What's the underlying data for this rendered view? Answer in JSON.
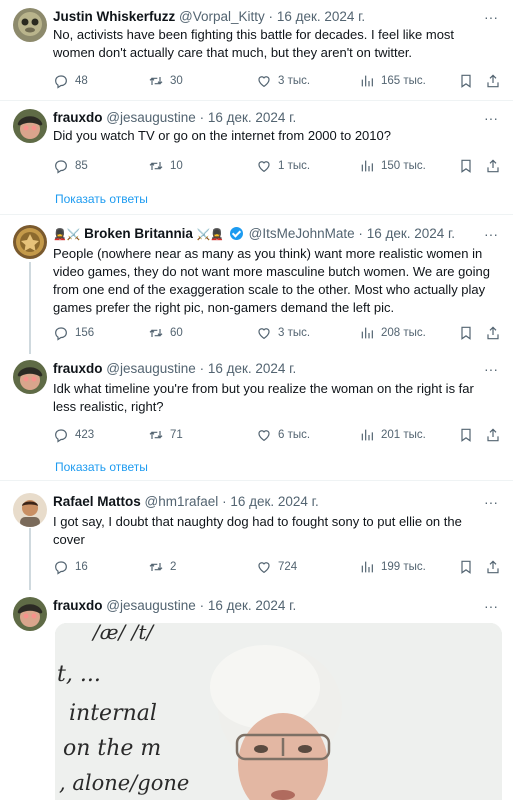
{
  "tweets": [
    {
      "name": "Justin Whiskerfuzz",
      "handle": "@Vorpal_Kitty",
      "date": "16 дек. 2024 г.",
      "text": "No, activists have been fighting this battle for decades. I feel like most women don't actually care that much, but they aren't on twitter.",
      "replies": "48",
      "retweets": "30",
      "likes": "3 тыс.",
      "views": "165 тыс."
    },
    {
      "name": "frauxdo",
      "handle": "@jesaugustine",
      "date": "16 дек. 2024 г.",
      "text": "Did you watch TV or go on the internet from 2000 to 2010?",
      "replies": "85",
      "retweets": "10",
      "likes": "1 тыс.",
      "views": "150 тыс.",
      "show_replies": "Показать ответы"
    },
    {
      "name_prefix": "💂‍♀️⚔️",
      "name": "Broken Britannia",
      "name_suffix": "⚔️💂‍♀️",
      "handle": "@ItsMeJohnMate",
      "date": "16 дек. 2024 г.",
      "text": "People (nowhere near as many as you think) want more realistic women in video games, they do not want more masculine butch women. We are going from one end of the exaggeration scale to the other. Most who actually play games prefer the right pic, non-gamers demand the left pic.",
      "replies": "156",
      "retweets": "60",
      "likes": "3 тыс.",
      "views": "208 тыс."
    },
    {
      "name": "frauxdo",
      "handle": "@jesaugustine",
      "date": "16 дек. 2024 г.",
      "text": "Idk what timeline you're from but you realize the woman on the right is far less realistic, right?",
      "replies": "423",
      "retweets": "71",
      "likes": "6 тыс.",
      "views": "201 тыс.",
      "show_replies": "Показать ответы"
    },
    {
      "name": "Rafael Mattos",
      "handle": "@hm1rafael",
      "date": "16 дек. 2024 г.",
      "text": "I got say, I doubt that naughty dog had to fought sony to put ellie on the cover",
      "replies": "16",
      "retweets": "2",
      "likes": "724",
      "views": "199 тыс."
    },
    {
      "name": "frauxdo",
      "handle": "@jesaugustine",
      "date": "16 дек. 2024 г.",
      "media": {
        "board_text": [
          "/æ/   /t/",
          "t, ...",
          "internal",
          "on the m",
          ", alone/gone"
        ]
      }
    }
  ],
  "icons": {
    "reply": "reply-icon",
    "retweet": "retweet-icon",
    "like": "heart-icon",
    "views": "views-icon",
    "bookmark": "bookmark-icon",
    "share": "share-icon",
    "more": "more-icon"
  },
  "colors": {
    "link": "#1d9bf0",
    "muted": "#536471",
    "verified": "#1d9bf0"
  }
}
